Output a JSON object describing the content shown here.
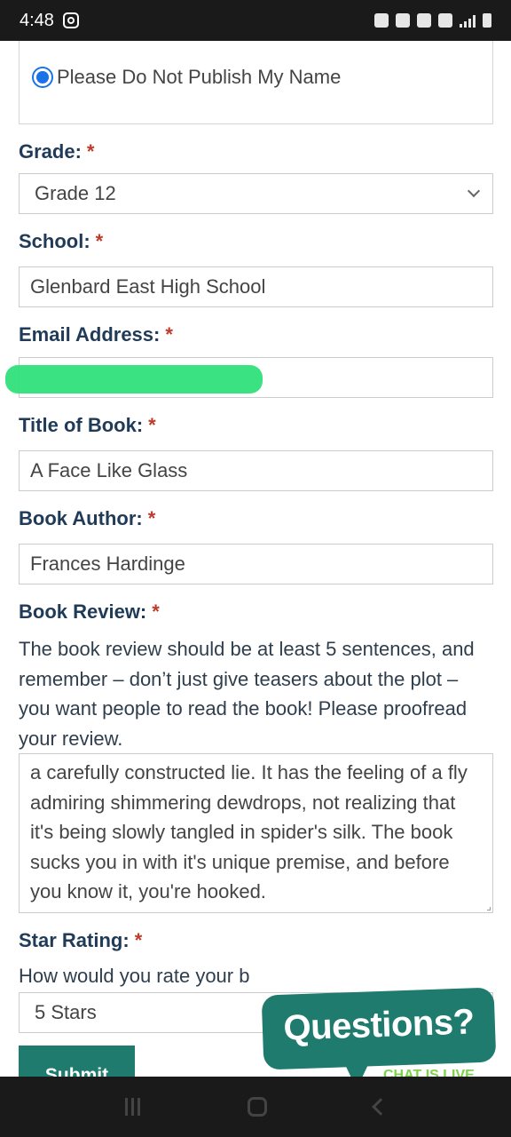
{
  "status_bar": {
    "time": "4:48",
    "icons": [
      "instagram-icon",
      "lock-icon",
      "alarm-icon",
      "mute-icon",
      "wifi-icon",
      "signal-icon",
      "battery-icon"
    ]
  },
  "form": {
    "name_option": "Please Do Not Publish My Name",
    "grade": {
      "label": "Grade:",
      "required": "*",
      "value": "Grade 12"
    },
    "school": {
      "label": "School:",
      "required": "*",
      "value": "Glenbard East High School"
    },
    "email": {
      "label": "Email Address:",
      "required": "*",
      "value": ""
    },
    "title": {
      "label": "Title of Book:",
      "required": "*",
      "value": "A Face Like Glass"
    },
    "author": {
      "label": "Book Author:",
      "required": "*",
      "value": "Frances Hardinge"
    },
    "review": {
      "label": "Book Review:",
      "required": "*",
      "help": "The book review should be at least 5 sentences, and remember – don’t just give teasers about the plot – you want people to read the book! Please proofread your review.",
      "value": "a carefully constructed lie. It has the feeling of a fly admiring shimmering dewdrops, not realizing that it's being slowly tangled in spider's silk. The book sucks you in with it's unique premise, and before you know it, you're hooked."
    },
    "rating": {
      "label": "Star Rating:",
      "required": "*",
      "question": "How would you rate your b",
      "value": "5 Stars"
    },
    "submit_label": "Submit"
  },
  "chat_widget": {
    "title": "Questions?",
    "subtitle": "CHAT IS LIVE"
  },
  "colors": {
    "label": "#1f3b57",
    "required": "#c0392b",
    "accent": "#1e7b6e",
    "radio": "#1a73e8",
    "live": "#7bd34a"
  }
}
